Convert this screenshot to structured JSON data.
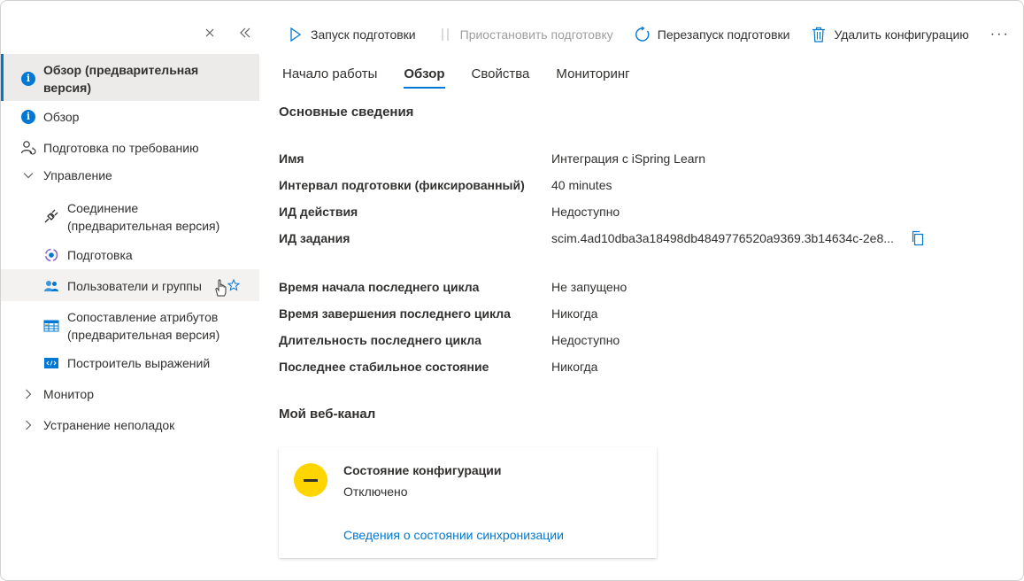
{
  "sidebar": {
    "items": [
      {
        "label": "Обзор (предварительная версия)",
        "line1": "Обзор (предварительная",
        "line2": "версия)"
      },
      {
        "label": "Обзор"
      },
      {
        "label": "Подготовка по требованию"
      },
      {
        "label": "Управление"
      },
      {
        "line1": "Соединение",
        "line2": "(предварительная версия)"
      },
      {
        "label": "Подготовка"
      },
      {
        "label": "Пользователи и группы"
      },
      {
        "line1": "Сопоставление атрибутов",
        "line2": "(предварительная версия)"
      },
      {
        "label": "Построитель выражений"
      },
      {
        "label": "Монитор"
      },
      {
        "label": "Устранение неполадок"
      }
    ]
  },
  "toolbar": {
    "start": "Запуск подготовки",
    "pause": "Приостановить подготовку",
    "restart": "Перезапуск подготовки",
    "delete": "Удалить конфигурацию",
    "more": "···"
  },
  "tabs": [
    "Начало работы",
    "Обзор",
    "Свойства",
    "Мониторинг"
  ],
  "basics": {
    "title": "Основные сведения",
    "rows": [
      {
        "k": "Имя",
        "v": "Интеграция с iSpring Learn"
      },
      {
        "k": "Интервал подготовки (фиксированный)",
        "v": "40 minutes"
      },
      {
        "k": "ИД действия",
        "v": "Недоступно"
      },
      {
        "k": "ИД задания",
        "v": "scim.4ad10dba3a18498db4849776520a9369.3b14634c-2e8..."
      }
    ],
    "rows2": [
      {
        "k": "Время начала последнего цикла",
        "v": "Не запущено"
      },
      {
        "k": "Время завершения последнего цикла",
        "v": "Никогда"
      },
      {
        "k": "Длительность последнего цикла",
        "v": "Недоступно"
      },
      {
        "k": "Последнее стабильное состояние",
        "v": "Никогда"
      }
    ]
  },
  "feed": {
    "title": "Мой веб-канал",
    "card_title": "Состояние конфигурации",
    "card_status": "Отключено",
    "card_link": "Сведения о состоянии синхронизации"
  },
  "colors": {
    "accent": "#0078d4",
    "status_disabled": "#ffd500"
  }
}
